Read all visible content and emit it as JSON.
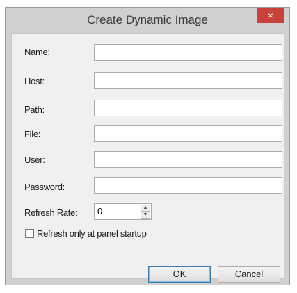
{
  "window": {
    "title": "Create Dynamic Image",
    "close_icon": "×"
  },
  "form": {
    "name_label": "Name:",
    "name_value": "",
    "host_label": "Host:",
    "host_value": "",
    "path_label": "Path:",
    "path_value": "",
    "file_label": "File:",
    "file_value": "",
    "user_label": "User:",
    "user_value": "",
    "password_label": "Password:",
    "password_value": "",
    "refresh_rate_label": "Refresh Rate:",
    "refresh_rate_value": "0",
    "refresh_startup_label": "Refresh only at panel startup",
    "refresh_startup_checked": false
  },
  "buttons": {
    "ok_label": "OK",
    "cancel_label": "Cancel"
  },
  "colors": {
    "close_button": "#c8413a",
    "default_button_border": "#3c7fb1"
  }
}
